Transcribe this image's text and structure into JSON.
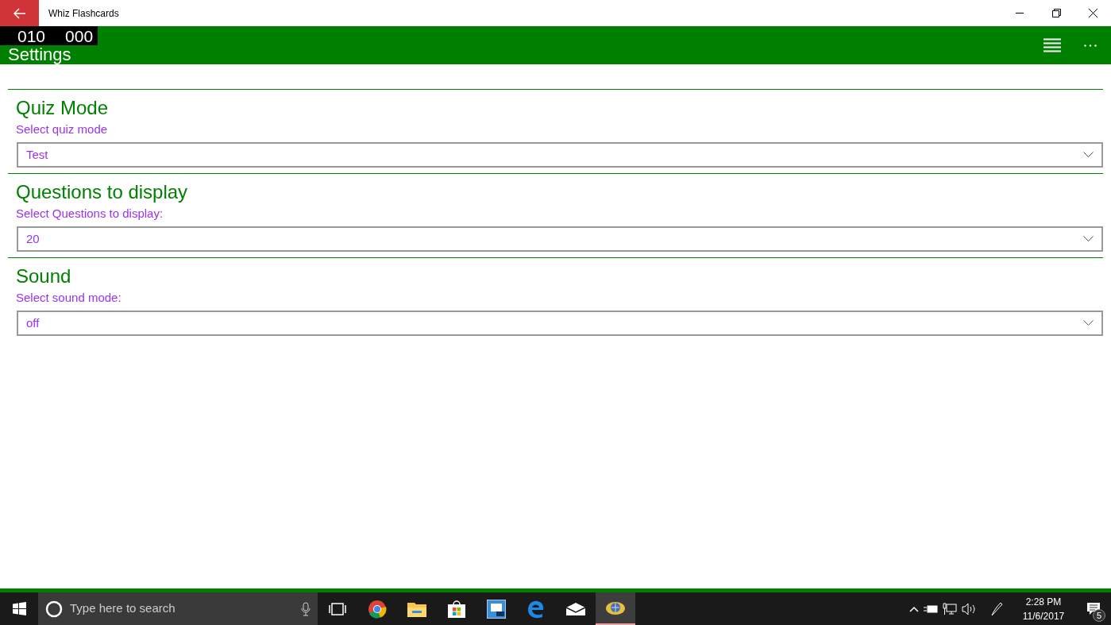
{
  "window": {
    "title": "Whiz Flashcards"
  },
  "counter": [
    "010",
    "000"
  ],
  "header": {
    "title": "Settings"
  },
  "sections": [
    {
      "heading": "Quiz Mode",
      "label": "Select quiz mode",
      "value": "Test"
    },
    {
      "heading": "Questions to display",
      "label": "Select Questions to display:",
      "value": "20"
    },
    {
      "heading": "Sound",
      "label": "Select sound mode:",
      "value": "off"
    }
  ],
  "taskbar": {
    "search_placeholder": "Type here to search",
    "apps": [
      {
        "kind": "chrome",
        "selected": false
      },
      {
        "kind": "folder",
        "selected": false
      },
      {
        "kind": "store",
        "selected": false
      },
      {
        "kind": "app",
        "selected": false
      },
      {
        "kind": "edge",
        "selected": false
      },
      {
        "kind": "mail",
        "selected": false
      },
      {
        "kind": "whiz",
        "selected": true
      }
    ],
    "time": "2:28 PM",
    "date": "11/6/2017",
    "notifications": "5"
  }
}
